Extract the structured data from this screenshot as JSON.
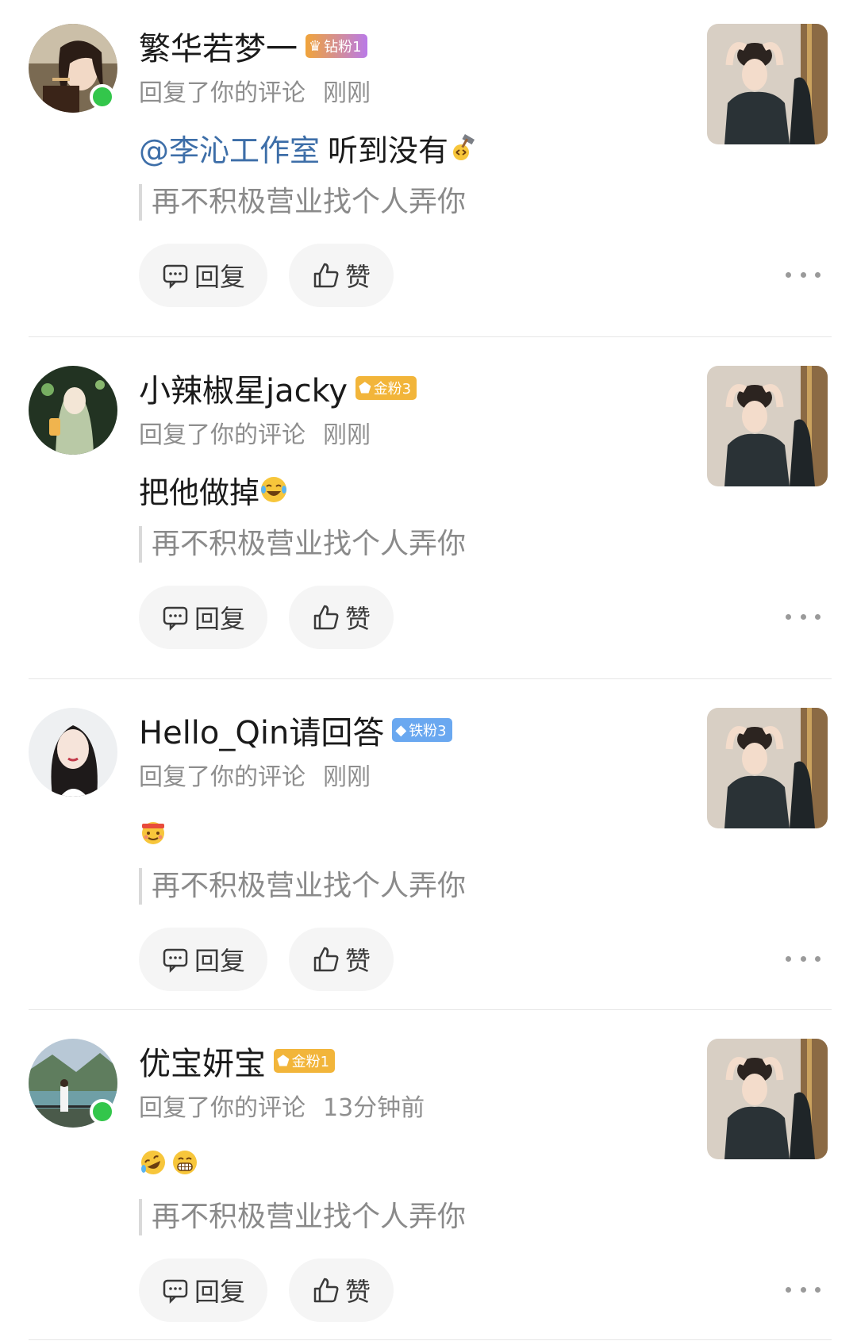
{
  "items": [
    {
      "name": "繁华若梦一",
      "badge": {
        "label": "钻粉1",
        "icon": "crown-icon",
        "color": "#b97ae8"
      },
      "online": true,
      "action": "回复了你的评论",
      "time": "刚刚",
      "mention": "@李沁工作室",
      "text": "听到没有",
      "emojis": [
        "hammer-emoji"
      ],
      "quote": "再不积极营业找个人弄你",
      "reply_label": "回复",
      "like_label": "赞"
    },
    {
      "name": "小辣椒星jacky",
      "badge": {
        "label": "金粉3",
        "icon": "gold-gem-icon",
        "color": "#f2b53a"
      },
      "online": false,
      "action": "回复了你的评论",
      "time": "刚刚",
      "mention": "",
      "text": "把他做掉",
      "emojis": [
        "laugh-cry-emoji"
      ],
      "quote": "再不积极营业找个人弄你",
      "reply_label": "回复",
      "like_label": "赞"
    },
    {
      "name": "Hello_Qin请回答",
      "badge": {
        "label": "铁粉3",
        "icon": "diamond-icon",
        "color": "#6aa8f0"
      },
      "online": false,
      "action": "回复了你的评论",
      "time": "刚刚",
      "mention": "",
      "text": "",
      "emojis": [
        "fighting-emoji"
      ],
      "quote": "再不积极营业找个人弄你",
      "reply_label": "回复",
      "like_label": "赞"
    },
    {
      "name": "优宝妍宝",
      "badge": {
        "label": "金粉1",
        "icon": "gold-gem-icon",
        "color": "#f2b53a"
      },
      "online": true,
      "action": "回复了你的评论",
      "time": "13分钟前",
      "mention": "",
      "text": "",
      "emojis": [
        "rolling-laugh-emoji",
        "grin-emoji"
      ],
      "quote": "再不积极营业找个人弄你",
      "reply_label": "回复",
      "like_label": "赞"
    }
  ]
}
